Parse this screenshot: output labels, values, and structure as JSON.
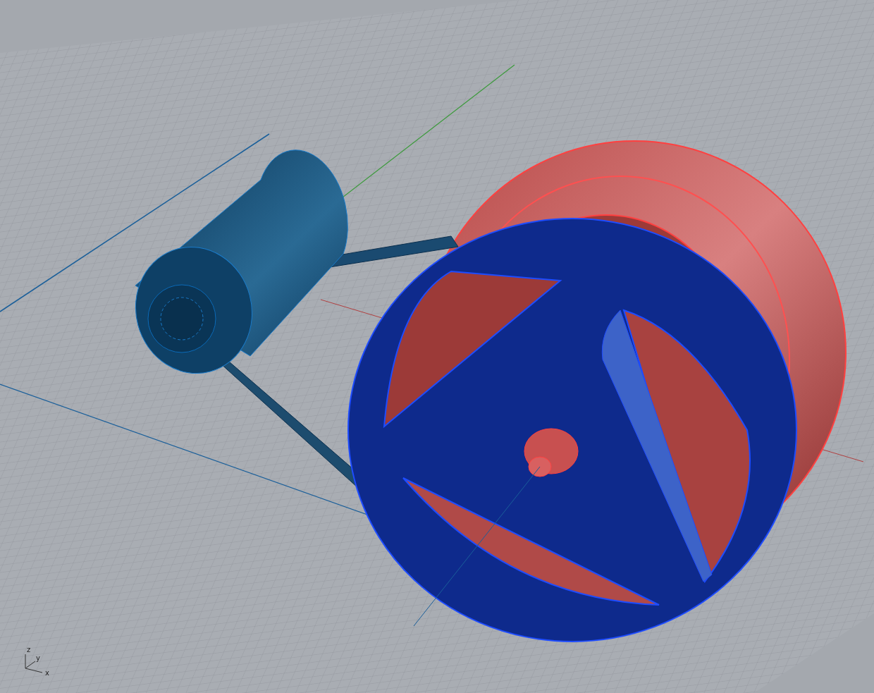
{
  "viewport": {
    "axis_labels": [
      "z",
      "y",
      "x"
    ]
  }
}
